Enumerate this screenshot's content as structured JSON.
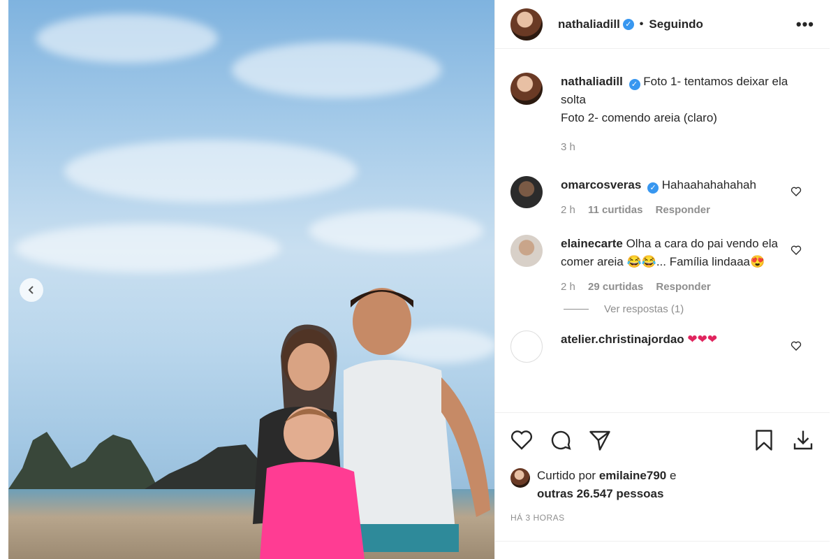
{
  "post": {
    "author": "nathaliadill",
    "follow_status": "Seguindo",
    "more_label": "•••",
    "verified_mark": "✓"
  },
  "caption": {
    "username": "nathaliadill",
    "line1": "Foto 1- tentamos deixar ela solta",
    "line2": "Foto 2- comendo areia (claro)",
    "time": "3 h"
  },
  "comments": [
    {
      "username": "omarcosveras",
      "verified": true,
      "text": "Hahaahahahahah",
      "time": "2 h",
      "likes": "11 curtidas",
      "reply": "Responder"
    },
    {
      "username": "elainecarte",
      "verified": false,
      "text": "Olha a cara do pai vendo ela comer areia 😂😂... Família lindaaa😍",
      "time": "2 h",
      "likes": "29 curtidas",
      "reply": "Responder",
      "view_replies": "Ver respostas (1)"
    },
    {
      "username": "atelier.christinajordao",
      "verified": false,
      "text": "❤❤❤"
    }
  ],
  "likes": {
    "prefix": "Curtido por",
    "user": "emilaine790",
    "middle": "e",
    "others": "outras 26.547 pessoas"
  },
  "timestamp": "HÁ 3 HORAS",
  "colors": {
    "verified": "#3897f0",
    "muted": "#8e8e8e",
    "text": "#262626"
  }
}
